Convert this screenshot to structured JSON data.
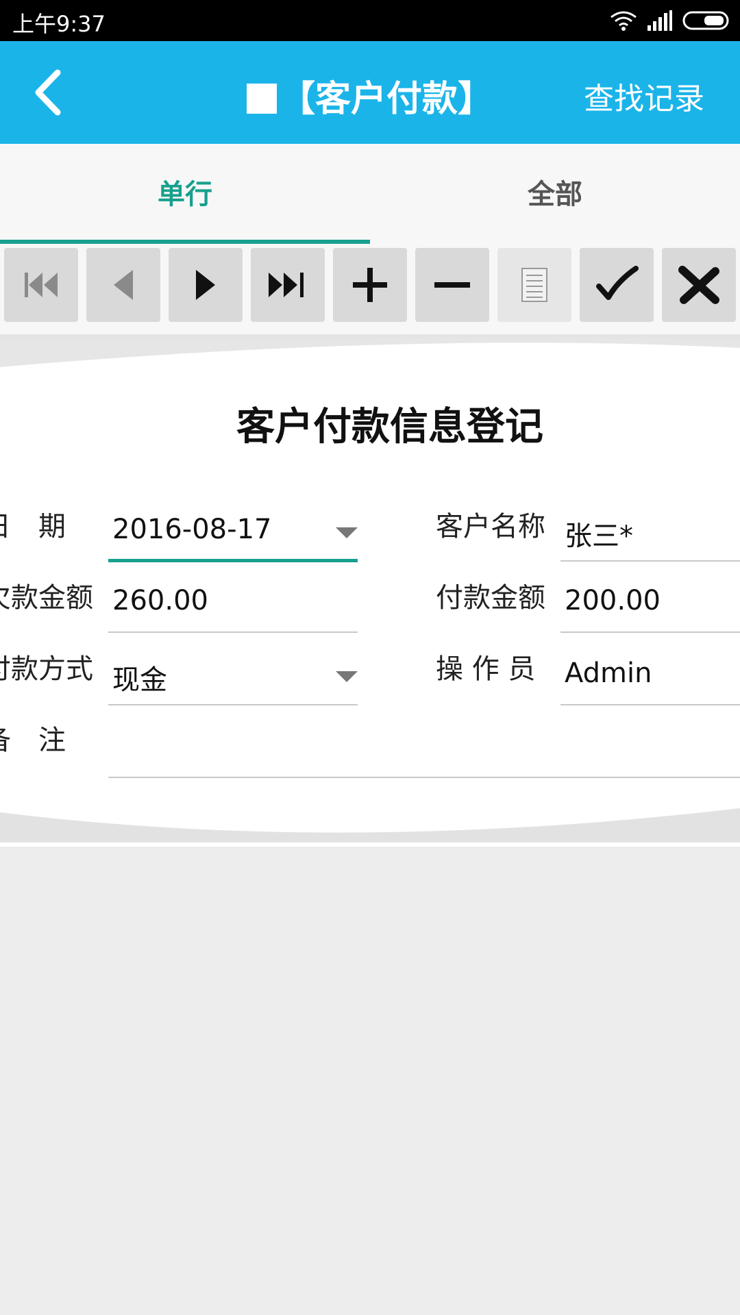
{
  "status": {
    "time": "上午9:37"
  },
  "topbar": {
    "title": "【客户付款】",
    "find_label": "查找记录"
  },
  "tabs": [
    {
      "label": "单行"
    },
    {
      "label": "全部"
    }
  ],
  "toolbar": {
    "buttons": [
      "first-icon",
      "prev-icon",
      "next-icon",
      "last-icon",
      "add-icon",
      "minus-icon",
      "document-icon",
      "check-icon",
      "close-icon"
    ]
  },
  "form": {
    "title": "客户付款信息登记",
    "fields": {
      "date": {
        "label": "日　期",
        "value": "2016-08-17"
      },
      "customer_name": {
        "label": "客户名称",
        "value": "张三*"
      },
      "receivable": {
        "label": "欠款金额",
        "value": "260.00"
      },
      "payment_amount": {
        "label": "付款金额",
        "value": "200.00"
      },
      "payment_method": {
        "label": "付款方式",
        "value": "现金"
      },
      "operator": {
        "label": "操 作 员",
        "value": "Admin"
      },
      "remark": {
        "label": "备　注",
        "value": ""
      }
    }
  },
  "colors": {
    "accent": "#1bb4e9",
    "active": "#17a08d"
  }
}
